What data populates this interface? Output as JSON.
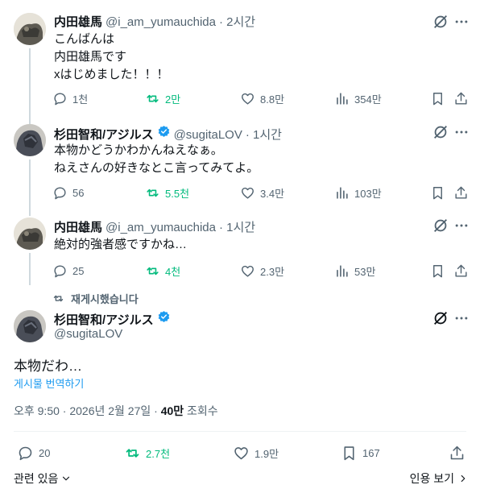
{
  "colors": {
    "accent": "#1d9bf0",
    "repost_green": "#00ba7c",
    "muted": "#536471",
    "text": "#0f1419"
  },
  "tweets": [
    {
      "name": "内田雄馬",
      "handle": "@i_am_yumauchida",
      "time": "· 2시간",
      "text": "こんばんは\n内田雄馬です\nxはじめました！！！",
      "replies": "1천",
      "reposts": "2만",
      "likes": "8.8만",
      "views": "354만"
    },
    {
      "name": "杉田智和/アジルス",
      "handle": "@sugitaLOV",
      "time": "· 1시간",
      "verified": true,
      "text": "本物かどうかわかんねえなぁ。\nねえさんの好きなとこ言ってみてよ。",
      "replies": "56",
      "reposts": "5.5천",
      "likes": "3.4만",
      "views": "103만"
    },
    {
      "name": "内田雄馬",
      "handle": "@i_am_yumauchida",
      "time": "· 1시간",
      "text": "絶対的強者感ですかね…",
      "replies": "25",
      "reposts": "4천",
      "likes": "2.3만",
      "views": "53만"
    }
  ],
  "main_tweet": {
    "repost_note": "재게시했습니다",
    "name": "杉田智和/アジルス",
    "handle": "@sugitaLOV",
    "verified": true,
    "text": "本物だわ…",
    "translate_label": "게시물 번역하기",
    "time": "오후 9:50 · 2026년 2월 27일 · ",
    "views_count": "40만",
    "views_label": " 조회수",
    "replies": "20",
    "reposts": "2.7천",
    "likes": "1.9만",
    "bookmarks": "167"
  },
  "footer": {
    "related_label": "관련 있음",
    "quotes_label": "인용 보기"
  }
}
